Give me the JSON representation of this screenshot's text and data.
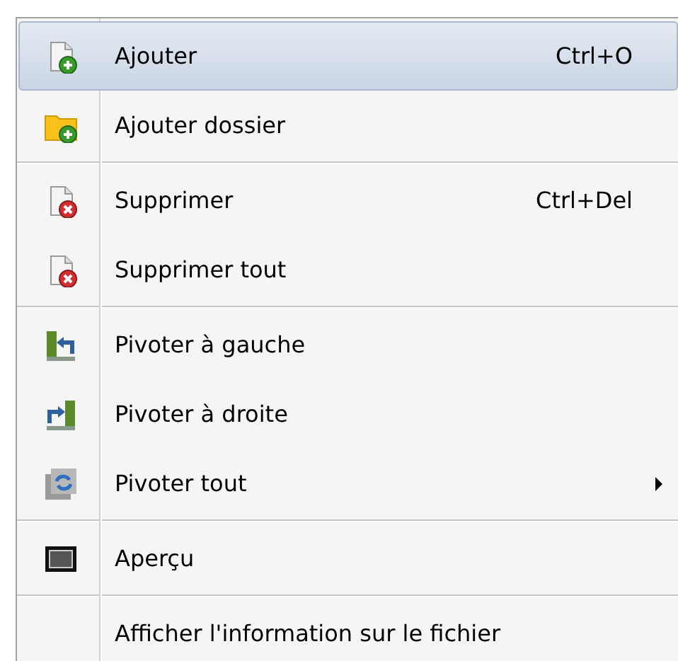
{
  "menu": {
    "sections": [
      {
        "items": [
          {
            "label": "Ajouter",
            "shortcut": "Ctrl+O",
            "selected": true,
            "submenu": false
          },
          {
            "label": "Ajouter dossier",
            "selected": false,
            "submenu": false
          }
        ]
      },
      {
        "items": [
          {
            "label": "Supprimer",
            "shortcut": "Ctrl+Del",
            "selected": false,
            "submenu": false
          },
          {
            "label": "Supprimer tout",
            "selected": false,
            "submenu": false
          }
        ]
      },
      {
        "items": [
          {
            "label": "Pivoter à gauche",
            "selected": false,
            "submenu": false
          },
          {
            "label": "Pivoter à droite",
            "selected": false,
            "submenu": false
          },
          {
            "label": "Pivoter tout",
            "selected": false,
            "submenu": true
          }
        ]
      },
      {
        "items": [
          {
            "label": "Aperçu",
            "selected": false,
            "submenu": false
          }
        ]
      },
      {
        "items": [
          {
            "label": "Afficher l'information sur le fichier",
            "selected": false,
            "submenu": false
          }
        ]
      }
    ]
  }
}
